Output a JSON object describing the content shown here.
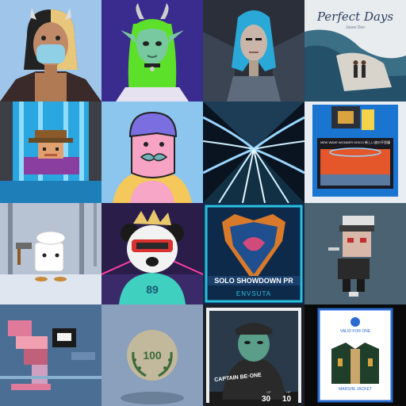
{
  "gallery": {
    "tiles": [
      {
        "icon": "masked-horned-girl-avatar"
      },
      {
        "icon": "green-horned-elf-avatar"
      },
      {
        "icon": "blue-haired-cyborg-avatar"
      },
      {
        "icon": "perfect-days-album-cover",
        "title": "Perfect Days",
        "subtitle": "Jason Deo"
      },
      {
        "icon": "pixel-cowboy-waterfall"
      },
      {
        "icon": "pink-cartoon-mustache-man"
      },
      {
        "icon": "blue-psychedelic-tunnel"
      },
      {
        "icon": "retro-floppy-disk-art",
        "label": "NEW WAVE WONDER DISCO 新しい波の不思議"
      },
      {
        "icon": "toast-chef-in-snowy-forest"
      },
      {
        "icon": "panda-vr-jersey-89",
        "number": "89"
      },
      {
        "icon": "solo-showdown-shield-badge",
        "banner": "SOLO SHOWDOWN PR",
        "brand": "ENVSUTA"
      },
      {
        "icon": "pixel-skull-smoker"
      },
      {
        "icon": "glitch-pixel-creature"
      },
      {
        "icon": "laurel-100-badge",
        "number": "100"
      },
      {
        "icon": "captain-card",
        "name": "CAPTAIN BE·ONE",
        "stat1_label": "CP",
        "stat1": "30",
        "stat2_label": "HP",
        "stat2": "10"
      },
      {
        "icon": "valid-ticket-jacket",
        "top_label": "VALID FOR ONE",
        "bottom_label": "MARSHE JACKET"
      }
    ]
  }
}
